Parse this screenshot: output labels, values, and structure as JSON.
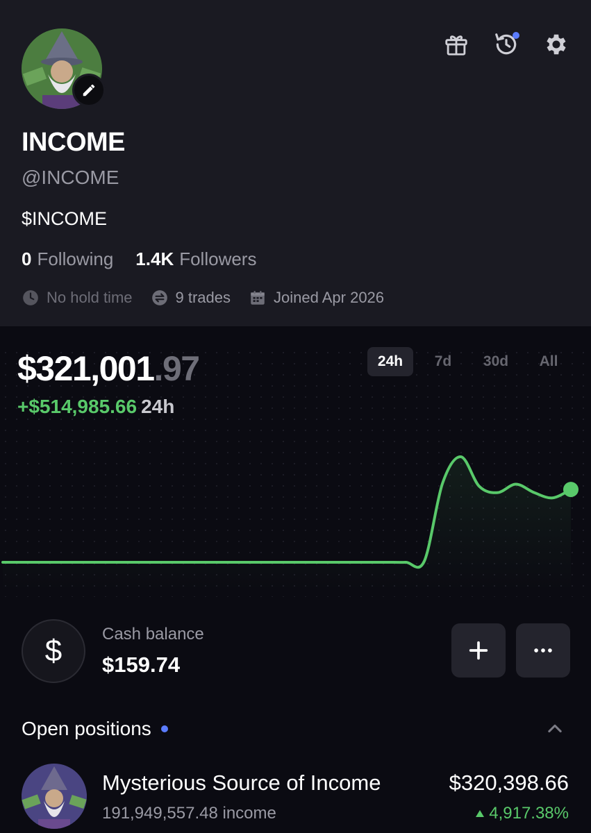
{
  "profile": {
    "display_name": "INCOME",
    "handle": "@INCOME",
    "ticker": "$INCOME",
    "following_count": "0",
    "following_label": "Following",
    "followers_count": "1.4K",
    "followers_label": "Followers",
    "hold_time": "No hold time",
    "trades": "9 trades",
    "joined": "Joined Apr 2026"
  },
  "header_icons": [
    "gift-icon",
    "history-icon",
    "settings-icon"
  ],
  "portfolio": {
    "value_main": "$321,001",
    "value_cents": ".97",
    "change_sign": "+",
    "change_amount": "$514,985.66",
    "change_period": "24h",
    "ranges": [
      "24h",
      "7d",
      "30d",
      "All"
    ],
    "active_range": "24h"
  },
  "chart_data": {
    "type": "line",
    "series": [
      {
        "values": [
          0.0,
          0.0,
          0.0,
          0.0,
          0.0,
          0.0,
          0.0,
          0.0,
          0.0,
          0.0,
          0.0,
          0.0,
          0.0,
          0.0,
          0.0,
          0.0,
          0.0,
          0.0,
          0.0,
          0.0,
          0.0,
          0.0,
          0.0,
          0.01,
          0.75,
          1.0,
          0.72,
          0.66,
          0.74,
          0.66,
          0.61,
          0.69
        ]
      }
    ],
    "color": "#59c96a",
    "grid": "dotted"
  },
  "cash": {
    "symbol": "$",
    "label": "Cash balance",
    "value": "$159.74"
  },
  "positions": {
    "title": "Open positions",
    "items": [
      {
        "name": "Mysterious Source of Income",
        "value": "$320,398.66",
        "quantity": "191,949,557.48 income",
        "change": "4,917.38%"
      }
    ]
  },
  "colors": {
    "accent_green": "#59c96a",
    "accent_blue": "#5b7cff",
    "background": "#0b0b12",
    "profile_bg": "#1a1a22"
  }
}
